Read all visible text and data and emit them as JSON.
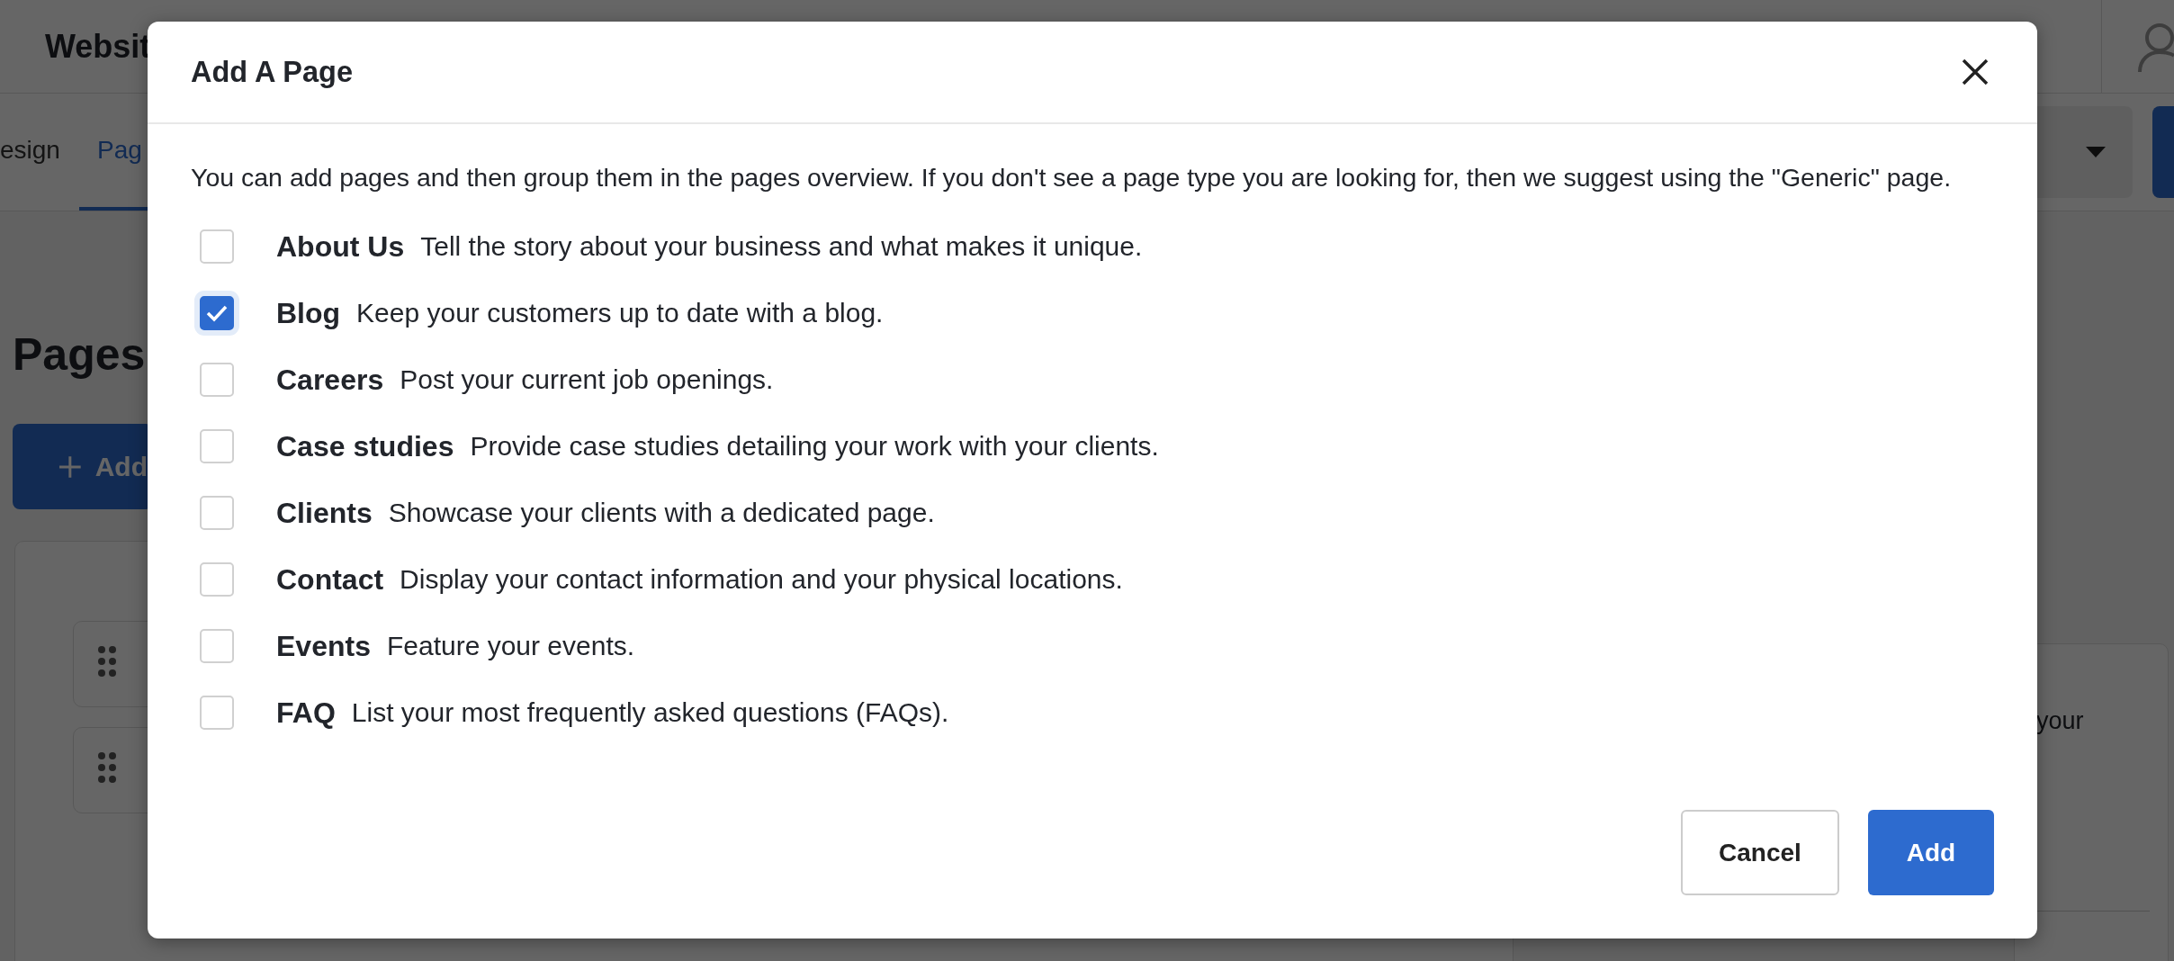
{
  "background": {
    "header_title": "Websit",
    "tabs": [
      {
        "label": "esign",
        "selected": false
      },
      {
        "label": "Pag",
        "selected": true
      }
    ],
    "heading": "Pages",
    "add_button": "Add",
    "side_text": "your"
  },
  "dialog": {
    "title": "Add A Page",
    "intro": "You can add pages and then group them in the pages overview. If you don't see a page type you are looking for, then we suggest using the \"Generic\" page.",
    "options": [
      {
        "name": "About Us",
        "description": "Tell the story about your business and what makes it unique.",
        "checked": false
      },
      {
        "name": "Blog",
        "description": "Keep your customers up to date with a blog.",
        "checked": true
      },
      {
        "name": "Careers",
        "description": "Post your current job openings.",
        "checked": false
      },
      {
        "name": "Case studies",
        "description": "Provide case studies detailing your work with your clients.",
        "checked": false
      },
      {
        "name": "Clients",
        "description": "Showcase your clients with a dedicated page.",
        "checked": false
      },
      {
        "name": "Contact",
        "description": "Display your contact information and your physical locations.",
        "checked": false
      },
      {
        "name": "Events",
        "description": "Feature your events.",
        "checked": false
      },
      {
        "name": "FAQ",
        "description": "List your most frequently asked questions (FAQs).",
        "checked": false
      }
    ],
    "cancel_button": "Cancel",
    "add_button": "Add"
  }
}
